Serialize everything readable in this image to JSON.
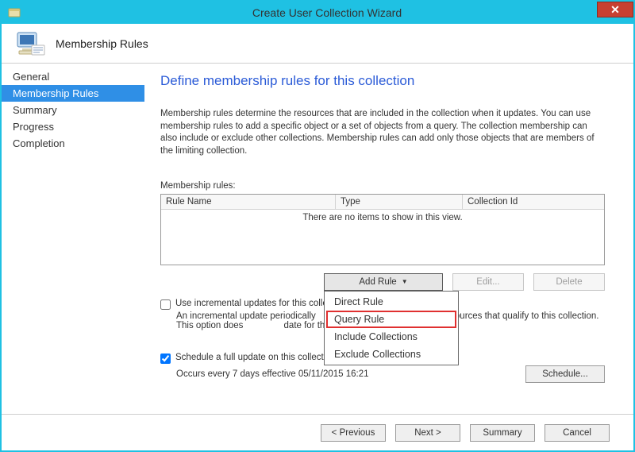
{
  "window": {
    "title": "Create User Collection Wizard"
  },
  "header": {
    "page_title": "Membership Rules"
  },
  "sidebar": {
    "steps": {
      "general": "General",
      "membership": "Membership Rules",
      "summary": "Summary",
      "progress": "Progress",
      "completion": "Completion"
    }
  },
  "content": {
    "heading": "Define membership rules for this collection",
    "description": "Membership rules determine the resources that are included in the collection when it updates. You can use membership rules to add a specific object or a set of objects from a query. The collection membership can also include or exclude other collections. Membership rules can add only those objects that are members of the limiting collection.",
    "list_label": "Membership rules:",
    "columns": {
      "rule_name": "Rule Name",
      "type": "Type",
      "collection_id": "Collection Id"
    },
    "empty_msg": "There are no items to show in this view.",
    "buttons": {
      "add_rule": "Add Rule",
      "edit": "Edit...",
      "delete": "Delete"
    },
    "add_rule_menu": {
      "direct": "Direct Rule",
      "query": "Query Rule",
      "include": "Include Collections",
      "exclude": "Exclude Collections"
    },
    "incremental": {
      "label": "Use incremental updates for this collection",
      "desc_a": "An incremental update periodically",
      "desc_b": "adds resources that qualify to this collection. This option does ",
      "desc_c": "date for this collection."
    },
    "schedule": {
      "label": "Schedule a full update on this collection",
      "occurs": "Occurs every 7 days effective 05/11/2015 16:21",
      "button": "Schedule..."
    }
  },
  "footer": {
    "previous": "< Previous",
    "next": "Next >",
    "summary": "Summary",
    "cancel": "Cancel"
  }
}
